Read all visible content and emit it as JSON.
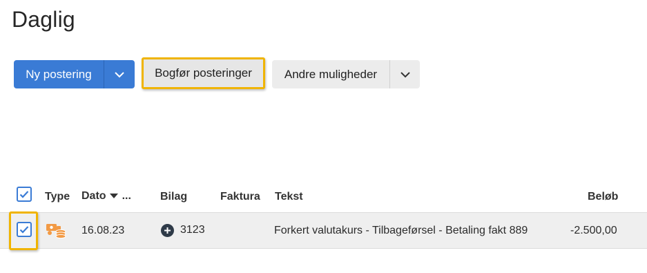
{
  "page": {
    "title": "Daglig"
  },
  "toolbar": {
    "new_entry_label": "Ny postering",
    "post_entries_label": "Bogfør posteringer",
    "more_options_label": "Andre muligheder"
  },
  "table": {
    "columns": {
      "type": "Type",
      "date": "Dato",
      "date_more": "...",
      "voucher": "Bilag",
      "invoice": "Faktura",
      "text": "Tekst",
      "amount": "Beløb"
    },
    "rows": [
      {
        "selected": true,
        "type_icon": "currency-exchange-icon",
        "date": "16.08.23",
        "voucher": "3123",
        "invoice": "",
        "text": "Forkert valutakurs - Tilbageførsel - Betaling fakt 889",
        "amount": "-2.500,00"
      }
    ]
  },
  "colors": {
    "primary": "#3a7bd5",
    "highlight": "#f0b400",
    "icon_orange": "#f29a45"
  }
}
